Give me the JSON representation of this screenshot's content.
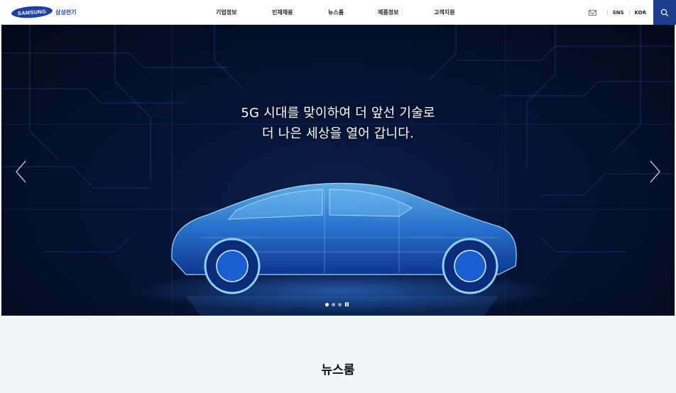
{
  "header": {
    "logo_text": "SAMSUNG",
    "logo_kr": "삼성전기",
    "nav": [
      "기업정보",
      "인재채용",
      "뉴스룸",
      "제품정보",
      "고객지원"
    ],
    "util": {
      "sns": "SNS",
      "lang": "KOR"
    },
    "icons": {
      "mail": "mail-icon",
      "search": "search-icon"
    }
  },
  "hero": {
    "line1": "5G 시대를 맞이하여 더 앞선 기술로",
    "line2": "더 나은 세상을 열어 갑니다.",
    "slides": 3,
    "active_slide": 1
  },
  "newsroom": {
    "title": "뉴스룸"
  },
  "colors": {
    "brand": "#1c3fa8",
    "search_bg": "#1e3c8c",
    "hero_glow": "#2f8cff"
  }
}
